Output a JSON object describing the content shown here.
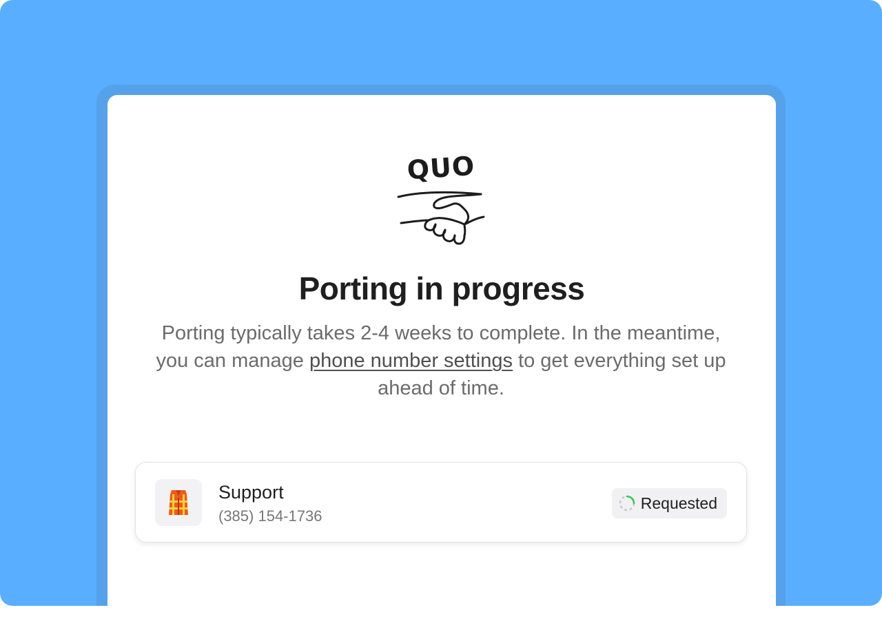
{
  "brand": {
    "name": "QUO",
    "logo_icon": "handshake-icon"
  },
  "header": {
    "title": "Porting in progress",
    "description_before": "Porting typically takes 2-4 weeks to complete. In the meantime, you can manage ",
    "link_text": "phone number settings",
    "description_after": " to get everything set up ahead of time."
  },
  "numbers": [
    {
      "name": "Support",
      "phone": "(385) 154-1736",
      "avatar_icon": "safety-vest-icon",
      "status": "Requested",
      "status_icon": "progress-spinner-icon",
      "status_color": "#2fc75a"
    }
  ],
  "colors": {
    "background": "#5aaeff",
    "frame": "#55a2ea",
    "card": "#ffffff"
  }
}
